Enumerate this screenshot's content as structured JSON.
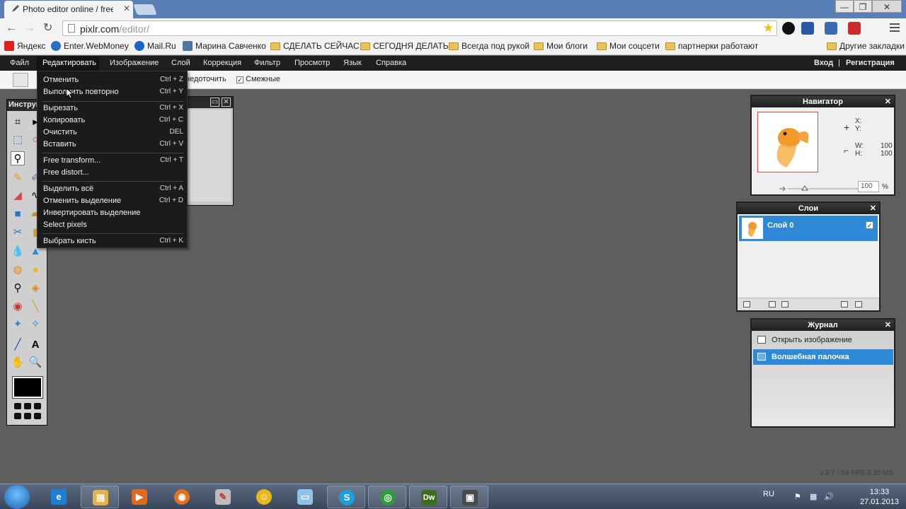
{
  "browser": {
    "tab_title": "Photo editor online / free",
    "tab_close": "✕",
    "url_host": "pixlr.com",
    "url_path": "/editor/",
    "win_min": "—",
    "win_max": "❐",
    "win_close": "✕"
  },
  "bookmarks": [
    {
      "label": "Яндекс",
      "kind": "site",
      "color": "#e0201b"
    },
    {
      "label": "Enter.WebMoney",
      "kind": "site",
      "color": "#2a6fc4"
    },
    {
      "label": "Mail.Ru",
      "kind": "site",
      "color": "#1a65c7"
    },
    {
      "label": "Марина Савченко",
      "kind": "site",
      "color": "#4d76a1"
    },
    {
      "label": "СДЕЛАТЬ СЕЙЧАС",
      "kind": "folder"
    },
    {
      "label": "СЕГОДНЯ ДЕЛАТЬ",
      "kind": "folder"
    },
    {
      "label": "Всегда под рукой",
      "kind": "folder"
    },
    {
      "label": "Мои блоги",
      "kind": "folder"
    },
    {
      "label": "Мои соцсети",
      "kind": "folder"
    },
    {
      "label": "партнерки работают",
      "kind": "folder"
    }
  ],
  "other_bookmarks": "Другие закладки",
  "menubar": {
    "items": [
      "Файл",
      "Редактировать",
      "Изображение",
      "Слой",
      "Коррекция",
      "Фильтр",
      "Просмотр",
      "Язык",
      "Справка"
    ],
    "login": "Вход",
    "divider": "|",
    "register": "Регистрация"
  },
  "optbar": {
    "antialias": "недоточить",
    "contiguous": "Смежные",
    "contiguous_checked": "✓"
  },
  "tools_title": "Инструменты",
  "edit_menu": [
    {
      "label": "Отменить",
      "shortcut": "Ctrl + Z"
    },
    {
      "label": "Выполнить повторно",
      "shortcut": "Ctrl + Y"
    },
    {
      "label": "Вырезать",
      "shortcut": "Ctrl + X"
    },
    {
      "label": "Копировать",
      "shortcut": "Ctrl + C"
    },
    {
      "label": "Очистить",
      "shortcut": "DEL"
    },
    {
      "label": "Вставить",
      "shortcut": "Ctrl + V"
    },
    {
      "label": "Free transform...",
      "shortcut": "Ctrl + T"
    },
    {
      "label": "Free distort...",
      "shortcut": ""
    },
    {
      "label": "Выделить всё",
      "shortcut": "Ctrl + A"
    },
    {
      "label": "Отменить выделение",
      "shortcut": "Ctrl + D"
    },
    {
      "label": "Инвертировать выделение",
      "shortcut": ""
    },
    {
      "label": "Select pixels",
      "shortcut": ""
    },
    {
      "label": "Выбрать кисть",
      "shortcut": "Ctrl + K"
    }
  ],
  "navigator": {
    "title": "Навигатор",
    "x_label": "X:",
    "y_label": "Y:",
    "w_label": "W:",
    "h_label": "H:",
    "w_value": "100",
    "h_value": "100",
    "zoom_value": "100",
    "zoom_unit": "%",
    "close": "✕"
  },
  "layers": {
    "title": "Слои",
    "layer_name": "Слой 0",
    "visible_check": "✓",
    "close": "✕"
  },
  "journal": {
    "title": "Журнал",
    "close": "✕",
    "entries": [
      {
        "label": "Открыть изображение",
        "selected": false
      },
      {
        "label": "Волшебная палочка",
        "selected": true
      }
    ]
  },
  "version_text": "v.8.7 - 56 FPS 9.30 MB",
  "taskbar": {
    "apps": [
      {
        "name": "ie-icon",
        "glyph": "e",
        "color": "#1e7fd6"
      },
      {
        "name": "explorer-icon",
        "glyph": "▤",
        "color": "#e3b34a"
      },
      {
        "name": "media-player-icon",
        "glyph": "▶",
        "color": "#e06a1c"
      },
      {
        "name": "firefox-icon",
        "glyph": "◉",
        "color": "#e0721c"
      },
      {
        "name": "paint-icon",
        "glyph": "✎",
        "color": "#d9d9d9"
      },
      {
        "name": "messenger-icon",
        "glyph": "☺",
        "color": "#e8b81e"
      },
      {
        "name": "notepad-icon",
        "glyph": "▭",
        "color": "#8fc4e8"
      },
      {
        "name": "skype-icon",
        "glyph": "S",
        "color": "#1c9fe0"
      },
      {
        "name": "chrome-icon",
        "glyph": "◎",
        "color": "#2d9c3a"
      },
      {
        "name": "dreamweaver-icon",
        "glyph": "Dw",
        "color": "#3b6e1f"
      },
      {
        "name": "camera-icon",
        "glyph": "▣",
        "color": "#4a4a4a"
      }
    ],
    "lang": "RU",
    "time": "13:33",
    "date": "27.01.2013"
  }
}
